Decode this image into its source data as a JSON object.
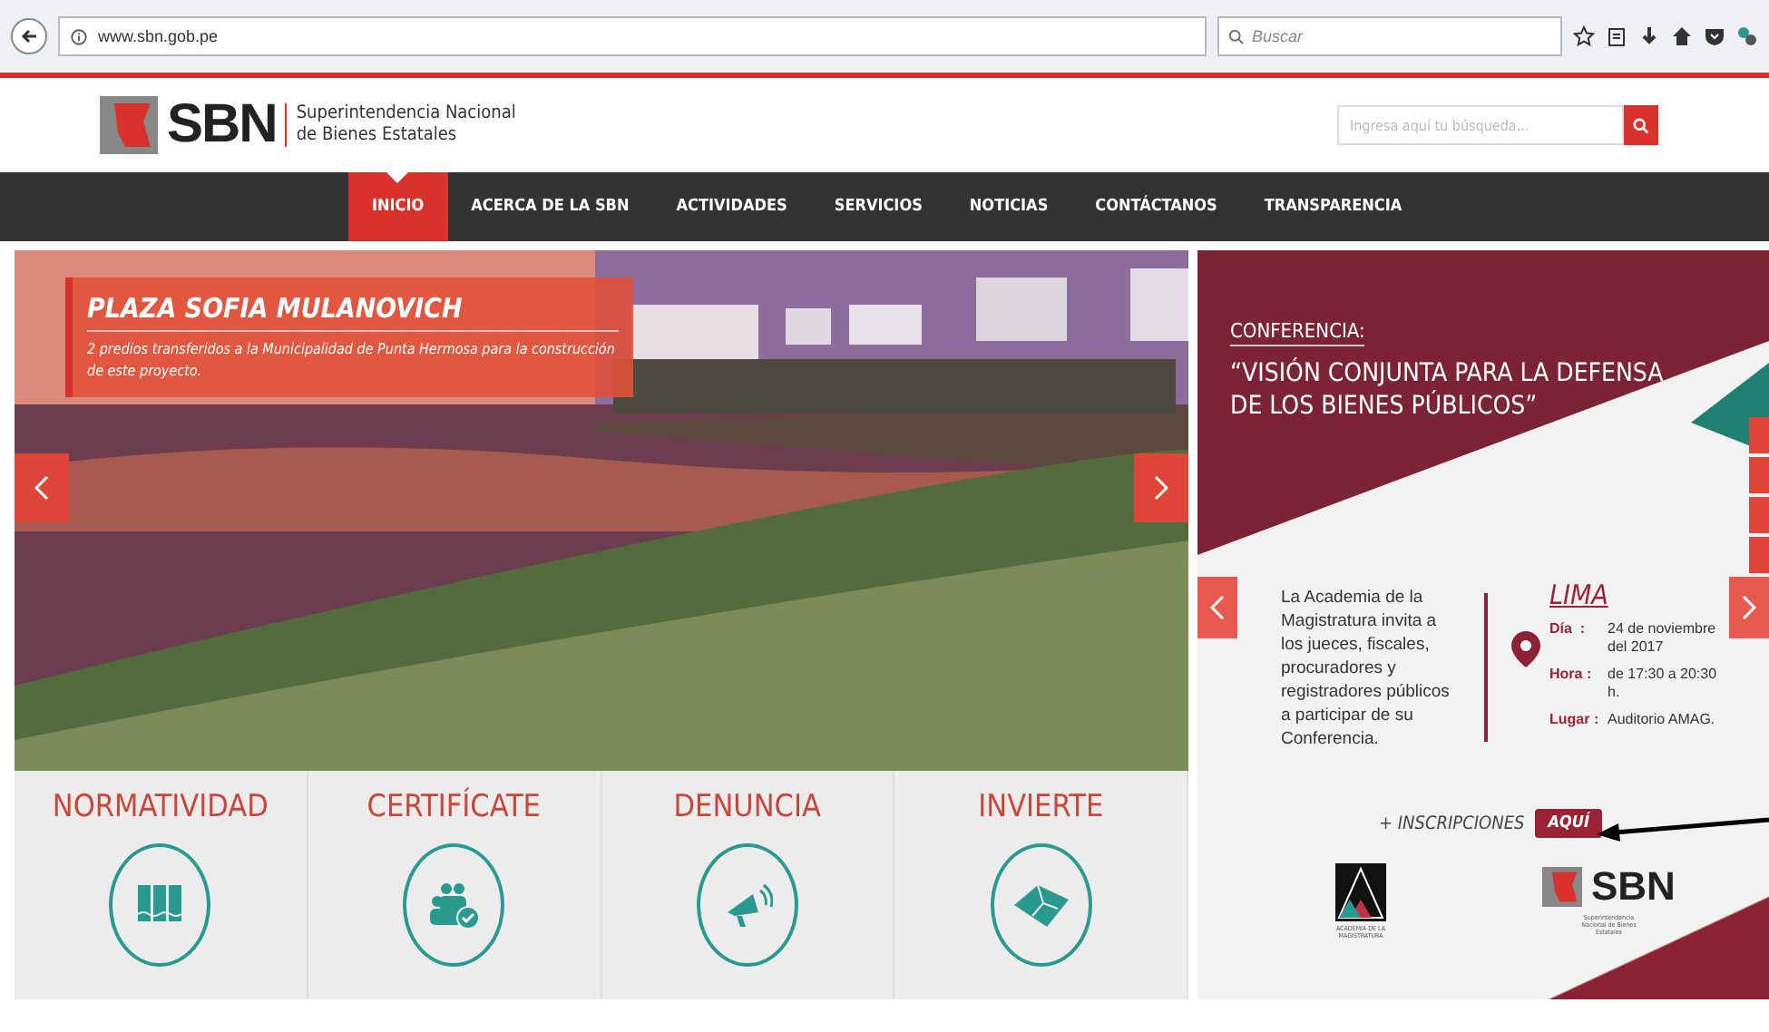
{
  "browser": {
    "url": "www.sbn.gob.pe",
    "search_placeholder": "Buscar"
  },
  "header": {
    "logo": "SBN",
    "subtitle_1": "Superintendencia Nacional",
    "subtitle_2": "de  Bienes  Estatales",
    "search_placeholder": "Ingresa aquí tu búsqueda..."
  },
  "nav": [
    {
      "label": "INICIO",
      "selected": true
    },
    {
      "label": "ACERCA DE LA SBN",
      "selected": false
    },
    {
      "label": "ACTIVIDADES",
      "selected": false
    },
    {
      "label": "SERVICIOS",
      "selected": false
    },
    {
      "label": "NOTICIAS",
      "selected": false
    },
    {
      "label": "CONTÁCTANOS",
      "selected": false
    },
    {
      "label": "TRANSPARENCIA",
      "selected": false
    }
  ],
  "slider": {
    "title": "PLAZA SOFIA MULANOVICH",
    "caption": "2 predios transferidos a la Municipalidad de Punta Hermosa  para la construcción de este proyecto."
  },
  "tiles": [
    {
      "label": "NORMATIVIDAD",
      "kind": "books"
    },
    {
      "label": "CERTIFÍCATE",
      "kind": "people"
    },
    {
      "label": "DENUNCIA",
      "kind": "megaphone"
    },
    {
      "label": "INVIERTE",
      "kind": "land"
    }
  ],
  "event": {
    "category": "CONFERENCIA:",
    "title": "“VISIÓN CONJUNTA PARA LA DEFENSA DE LOS BIENES PÚBLICOS”",
    "body": "La Academia de la Magistratura invita a los jueces, fiscales, procuradores y registradores públicos a participar de su Conferencia.",
    "city": "LIMA",
    "details": [
      {
        "label": "Día  :",
        "value": "24 de noviembre del 2017"
      },
      {
        "label": "Hora :",
        "value": "de 17:30 a 20:30 h."
      },
      {
        "label": "Lugar :",
        "value": "Auditorio AMAG."
      }
    ],
    "registration": "+ INSCRIPCIONES",
    "registration_button": "AQUÍ",
    "partners": [
      {
        "kind": "academy",
        "caption": "ACADEMIA DE LA MAGISTRATURA"
      },
      {
        "kind": "sbn",
        "logo": "SBN",
        "caption": "Superintendencia Nacional de Bienes Estatales"
      }
    ]
  }
}
